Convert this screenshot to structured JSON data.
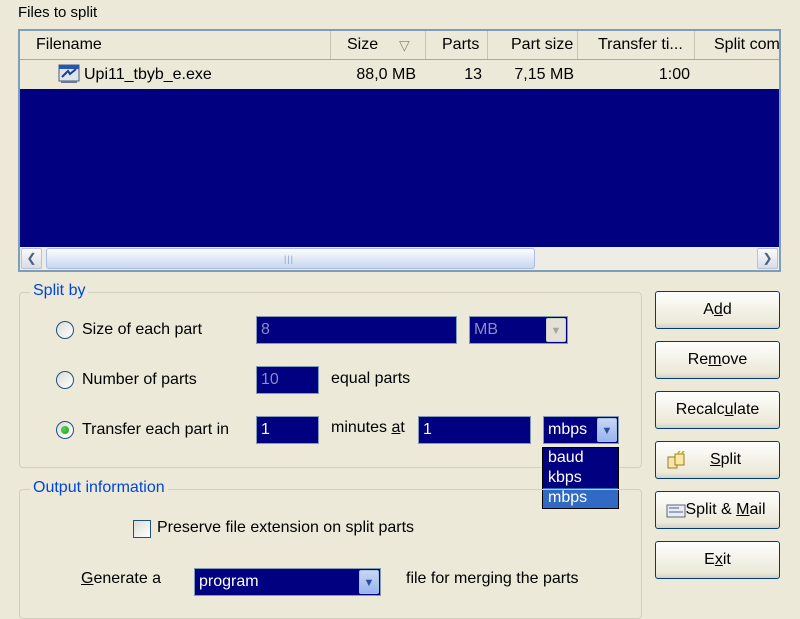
{
  "files_group": {
    "label": "Files to split",
    "columns": [
      "Filename",
      "Size",
      "Parts",
      "Part size",
      "Transfer ti...",
      "Split com"
    ],
    "rows": [
      {
        "filename": "Upi11_tbyb_e.exe",
        "size": "88,0 MB",
        "parts": "13",
        "part_size": "7,15 MB",
        "transfer_time": "1:00",
        "split_com": ""
      }
    ],
    "sort_indicator": "▽",
    "scroll_grip": "|||"
  },
  "split_by": {
    "title": "Split by",
    "size_option": {
      "label": "Size of each part",
      "value": "8",
      "unit": "MB",
      "selected": false
    },
    "number_option": {
      "label": "Number of parts",
      "value": "10",
      "suffix": "equal parts",
      "selected": false
    },
    "transfer_option": {
      "label": "Transfer each part in",
      "minutes": "1",
      "minutes_label_pre": "minutes ",
      "minutes_label_ul": "a",
      "minutes_label_post": "t",
      "speed": "1",
      "speed_unit": "mbps",
      "selected": true
    }
  },
  "speed_unit_dropdown": {
    "options": [
      "baud",
      "kbps",
      "mbps"
    ],
    "selected": "mbps"
  },
  "output_group": {
    "title": "Output information",
    "preserve_ext_label": "Preserve file extension on split parts",
    "preserve_ext_checked": false,
    "generate_label_ul": "G",
    "generate_label_rest": "enerate a",
    "generate_value": "program",
    "merge_label": "file for merging the parts"
  },
  "buttons": {
    "add": {
      "pre": "A",
      "ul": "d",
      "post": "d"
    },
    "remove": {
      "pre": "Re",
      "ul": "m",
      "post": "ove"
    },
    "recalculate": {
      "pre": "Recalc",
      "ul": "u",
      "post": "late"
    },
    "split": {
      "pre": "",
      "ul": "S",
      "post": "plit"
    },
    "split_mail": {
      "pre": "Split & ",
      "ul": "M",
      "post": "ail"
    },
    "exit": {
      "pre": "E",
      "ul": "x",
      "post": "it"
    }
  },
  "colors": {
    "list_bg": "#000080",
    "selection": "#316ac5",
    "group_title": "#0046d5",
    "window_bg": "#ece9d8"
  }
}
